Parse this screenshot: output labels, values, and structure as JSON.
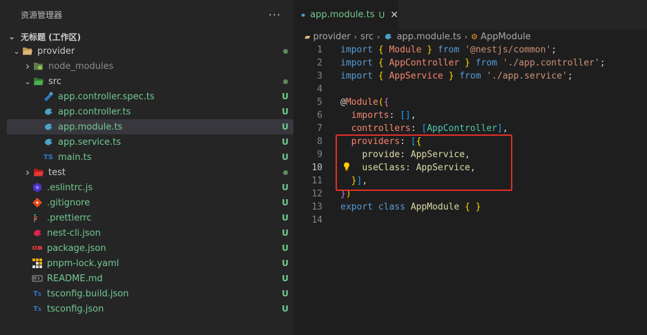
{
  "sidebar": {
    "title": "资源管理器",
    "more": "···",
    "workspace": "无标题 (工作区)",
    "items": [
      {
        "label": "provider",
        "icon": "folder-open-icon",
        "indent": 0,
        "chev": "open",
        "status": "dot",
        "style": "normal"
      },
      {
        "label": "node_modules",
        "icon": "node-folder-icon",
        "indent": 1,
        "chev": "closed",
        "status": "",
        "style": "dim"
      },
      {
        "label": "src",
        "icon": "src-folder-icon",
        "indent": 1,
        "chev": "open",
        "status": "dot",
        "style": "normal"
      },
      {
        "label": "app.controller.spec.ts",
        "icon": "spec-icon",
        "indent": 2,
        "chev": "",
        "status": "U",
        "style": "green"
      },
      {
        "label": "app.controller.ts",
        "icon": "nest-icon",
        "indent": 2,
        "chev": "",
        "status": "U",
        "style": "green"
      },
      {
        "label": "app.module.ts",
        "icon": "nest-icon",
        "indent": 2,
        "chev": "",
        "status": "U",
        "style": "green",
        "selected": true
      },
      {
        "label": "app.service.ts",
        "icon": "nest-icon",
        "indent": 2,
        "chev": "",
        "status": "U",
        "style": "green"
      },
      {
        "label": "main.ts",
        "icon": "typescript-icon",
        "indent": 2,
        "chev": "",
        "status": "U",
        "style": "green"
      },
      {
        "label": "test",
        "icon": "test-folder-icon",
        "indent": 1,
        "chev": "closed",
        "status": "dot",
        "style": "normal"
      },
      {
        "label": ".eslintrc.js",
        "icon": "eslint-icon",
        "indent": 1,
        "chev": "",
        "status": "U",
        "style": "green"
      },
      {
        "label": ".gitignore",
        "icon": "git-icon",
        "indent": 1,
        "chev": "",
        "status": "U",
        "style": "green"
      },
      {
        "label": ".prettierrc",
        "icon": "prettier-icon",
        "indent": 1,
        "chev": "",
        "status": "U",
        "style": "green"
      },
      {
        "label": "nest-cli.json",
        "icon": "nest-cli-icon",
        "indent": 1,
        "chev": "",
        "status": "U",
        "style": "green"
      },
      {
        "label": "package.json",
        "icon": "npm-icon",
        "indent": 1,
        "chev": "",
        "status": "U",
        "style": "green"
      },
      {
        "label": "pnpm-lock.yaml",
        "icon": "pnpm-icon",
        "indent": 1,
        "chev": "",
        "status": "U",
        "style": "green"
      },
      {
        "label": "README.md",
        "icon": "markdown-icon",
        "indent": 1,
        "chev": "",
        "status": "U",
        "style": "green"
      },
      {
        "label": "tsconfig.build.json",
        "icon": "tsconfig-icon",
        "indent": 1,
        "chev": "",
        "status": "U",
        "style": "green"
      },
      {
        "label": "tsconfig.json",
        "icon": "tsconfig-icon",
        "indent": 1,
        "chev": "",
        "status": "U",
        "style": "green"
      }
    ]
  },
  "tab": {
    "label": "app.module.ts",
    "modified": "U",
    "close": "✕"
  },
  "breadcrumb": [
    "provider",
    "src",
    "app.module.ts",
    "AppModule"
  ],
  "code": {
    "active_line": 10,
    "lines": [
      [
        [
          "kb",
          "import"
        ],
        [
          "w",
          " "
        ],
        [
          "b1",
          "{"
        ],
        [
          "w",
          " "
        ],
        [
          "err",
          "Module"
        ],
        [
          "w",
          " "
        ],
        [
          "b1",
          "}"
        ],
        [
          "w",
          " "
        ],
        [
          "kb",
          "from"
        ],
        [
          "w",
          " "
        ],
        [
          "s",
          "'@nestjs/common'"
        ],
        [
          "w",
          ";"
        ]
      ],
      [
        [
          "kb",
          "import"
        ],
        [
          "w",
          " "
        ],
        [
          "b1",
          "{"
        ],
        [
          "w",
          " "
        ],
        [
          "err",
          "AppController"
        ],
        [
          "w",
          " "
        ],
        [
          "b1",
          "}"
        ],
        [
          "w",
          " "
        ],
        [
          "kb",
          "from"
        ],
        [
          "w",
          " "
        ],
        [
          "s",
          "'./app.controller'"
        ],
        [
          "w",
          ";"
        ]
      ],
      [
        [
          "kb",
          "import"
        ],
        [
          "w",
          " "
        ],
        [
          "b1",
          "{"
        ],
        [
          "w",
          " "
        ],
        [
          "err",
          "AppService"
        ],
        [
          "w",
          " "
        ],
        [
          "b1",
          "}"
        ],
        [
          "w",
          " "
        ],
        [
          "kb",
          "from"
        ],
        [
          "w",
          " "
        ],
        [
          "s",
          "'./app.service'"
        ],
        [
          "w",
          ";"
        ]
      ],
      [],
      [
        [
          "w",
          "@"
        ],
        [
          "err",
          "Module"
        ],
        [
          "b1",
          "("
        ],
        [
          "b2",
          "{"
        ]
      ],
      [
        [
          "w",
          "  "
        ],
        [
          "err",
          "imports"
        ],
        [
          "w",
          ": "
        ],
        [
          "b3",
          "[]"
        ],
        [
          "w",
          ","
        ]
      ],
      [
        [
          "w",
          "  "
        ],
        [
          "err",
          "controllers"
        ],
        [
          "w",
          ": "
        ],
        [
          "b3",
          "["
        ],
        [
          "t",
          "AppController"
        ],
        [
          "b3",
          "]"
        ],
        [
          "w",
          ","
        ]
      ],
      [
        [
          "w",
          "  "
        ],
        [
          "err",
          "providers"
        ],
        [
          "w",
          ": "
        ],
        [
          "b3",
          "["
        ],
        [
          "b1",
          "{"
        ]
      ],
      [
        [
          "w",
          "    "
        ],
        [
          "dec",
          "provide"
        ],
        [
          "w",
          ": "
        ],
        [
          "dec",
          "AppService"
        ],
        [
          "w",
          ","
        ]
      ],
      [
        [
          "w",
          "    "
        ],
        [
          "dec",
          "useClass"
        ],
        [
          "w",
          ": "
        ],
        [
          "dec",
          "AppService"
        ],
        [
          "w",
          ","
        ]
      ],
      [
        [
          "w",
          "  "
        ],
        [
          "b1",
          "}"
        ],
        [
          "b3",
          "]"
        ],
        [
          "w",
          ","
        ]
      ],
      [
        [
          "b2",
          "}"
        ],
        [
          "b1",
          ")"
        ]
      ],
      [
        [
          "kb",
          "export"
        ],
        [
          "w",
          " "
        ],
        [
          "kb",
          "class"
        ],
        [
          "w",
          " "
        ],
        [
          "dec",
          "AppModule"
        ],
        [
          "w",
          " "
        ],
        [
          "b1",
          "{"
        ],
        [
          "w",
          " "
        ],
        [
          "b1",
          "}"
        ]
      ],
      []
    ]
  },
  "colors": {
    "accent_untracked": "#73c991",
    "highlight_box": "#e0302a",
    "bulb": "#ffcc00"
  }
}
